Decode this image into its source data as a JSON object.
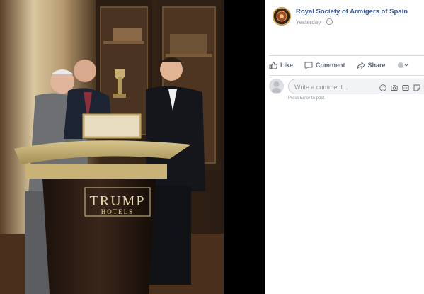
{
  "post": {
    "page_name": "Royal Society of Armigers of Spain",
    "timestamp": "Yesterday",
    "separator": "·"
  },
  "actions": {
    "like": "Like",
    "comment": "Comment",
    "share": "Share"
  },
  "comment_box": {
    "placeholder": "Write a comment...",
    "hint": "Press Enter to post."
  },
  "photo": {
    "podium_brand": "TRUMP",
    "podium_sub": "HOTELS"
  },
  "colors": {
    "link": "#385898",
    "muted": "#606770",
    "divider": "#dadde1"
  }
}
